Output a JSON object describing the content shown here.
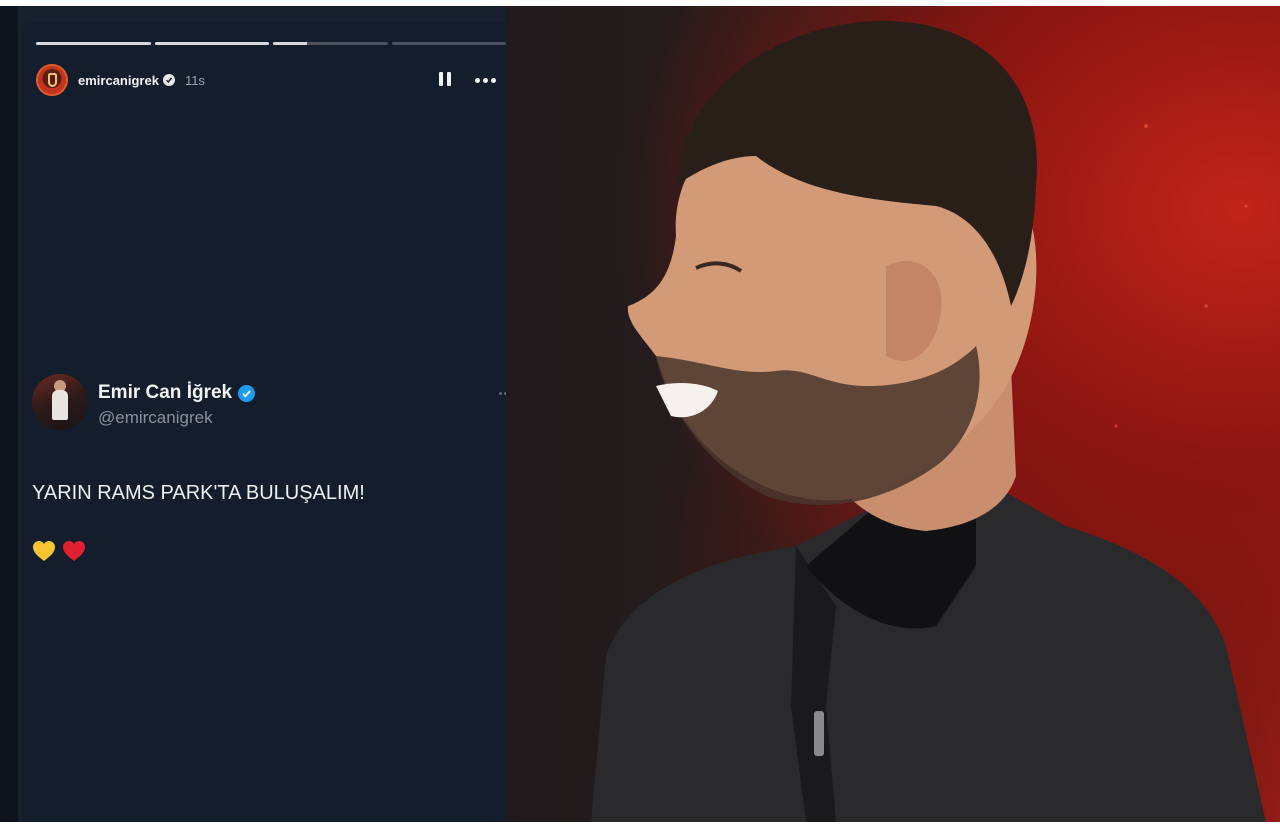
{
  "story": {
    "username": "emircanigrek",
    "time": "11s",
    "progress": [
      1,
      1,
      0.3,
      0
    ],
    "icons": {
      "avatar": "story-avatar",
      "verified": "verified-badge-icon",
      "pause": "pause-icon",
      "more": "more-options-icon"
    }
  },
  "tweet": {
    "display_name": "Emir Can İğrek",
    "handle": "@emircanigrek",
    "text": "YARIN RAMS PARK'TA BULUŞALIM!",
    "emoji": [
      "yellow-heart",
      "red-heart"
    ],
    "colors": {
      "verified": "#1d9bf0",
      "yellow_heart": "#f7c531",
      "red_heart": "#e0202e"
    }
  },
  "photo": {
    "subject": "smiling-man-profile-photo"
  }
}
